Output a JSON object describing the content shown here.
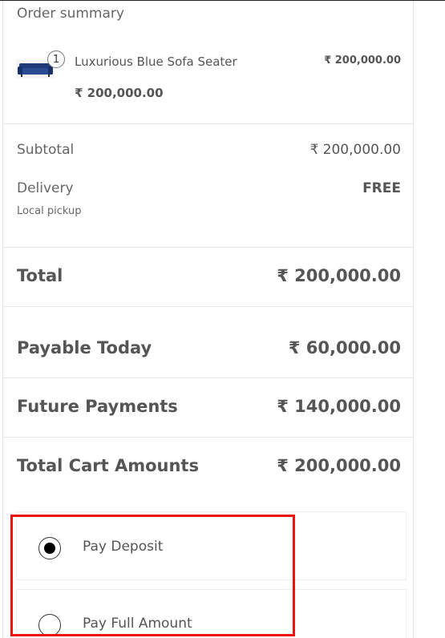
{
  "summary": {
    "title": "Order summary",
    "item": {
      "name": "Luxurious Blue Sofa Seater",
      "quantity": "1",
      "price": "₹ 200,000.00",
      "line_total": "₹ 200,000.00",
      "thumbnail_icon": "sofa-thumbnail"
    }
  },
  "totals": {
    "subtotal_label": "Subtotal",
    "subtotal_value": "₹ 200,000.00",
    "delivery_label": "Delivery",
    "delivery_value": "FREE",
    "delivery_method": "Local pickup",
    "total_label": "Total",
    "total_value": "₹ 200,000.00",
    "payable_today_label": "Payable Today",
    "payable_today_value": "₹ 60,000.00",
    "future_payments_label": "Future Payments",
    "future_payments_value": "₹ 140,000.00",
    "total_cart_label": "Total Cart Amounts",
    "total_cart_value": "₹ 200,000.00"
  },
  "payment_options": [
    {
      "label": "Pay Deposit",
      "selected": true
    },
    {
      "label": "Pay Full Amount",
      "selected": false
    }
  ],
  "colors": {
    "text": "#555555",
    "highlight": "#ee1111",
    "sofa": "#1f3a78"
  }
}
